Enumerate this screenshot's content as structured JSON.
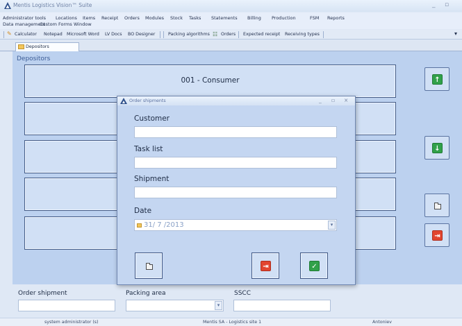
{
  "window": {
    "title": "Mentis Logistics Vision™ Suite"
  },
  "menu": {
    "row1": [
      "Administrator tools",
      "Locations",
      "Items",
      "Receipt",
      "Orders",
      "Modules",
      "Stock",
      "Tasks",
      "Statements",
      "Billing",
      "Production",
      "FSM",
      "Reports"
    ],
    "row2": [
      "Data management",
      "Custom Forms",
      "Window"
    ]
  },
  "toolbar": {
    "calculator": "Calculator",
    "notepad": "Notepad",
    "word": "Microsoft Word",
    "lvdocs": "LV Docs",
    "bodesigner": "BO Designer",
    "packing": "Packing algorithms",
    "orders": "Orders",
    "expected": "Expected receipt",
    "receiving": "Receiving types"
  },
  "tab": {
    "label": "Depositors"
  },
  "depositors": {
    "label": "Depositors",
    "items": [
      "001 - Consumer",
      "",
      "",
      "",
      ""
    ]
  },
  "bottom": {
    "order_shipment_label": "Order shipment",
    "packing_area_label": "Packing area",
    "sscc_label": "SSCC"
  },
  "status": {
    "user": "system administrator (s)",
    "company": "Mentis SA - Logistics site 1",
    "host": "Antoniev"
  },
  "dialog": {
    "title": "Order shipments",
    "customer_label": "Customer",
    "tasklist_label": "Task list",
    "shipment_label": "Shipment",
    "date_label": "Date",
    "date_value": "31/ 7 /2013"
  },
  "icons": {
    "up": "arrow-up-icon",
    "down": "arrow-down-icon",
    "exit": "exit-icon",
    "confirm": "checkmark-icon",
    "folder": "folder-icon"
  }
}
